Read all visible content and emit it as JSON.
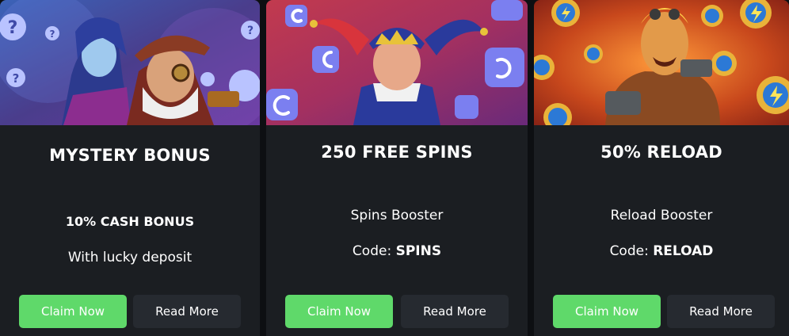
{
  "colors": {
    "accent_green": "#5fd96a",
    "card_bg": "#1b1e22",
    "button_dark": "#262a30"
  },
  "cards": [
    {
      "title": "MYSTERY BONUS",
      "line1": "10% CASH BONUS",
      "line2": "With lucky deposit",
      "claim_label": "Claim Now",
      "read_label": "Read More",
      "image_icons": [
        "question-mark-icon"
      ]
    },
    {
      "title": "250 FREE SPINS",
      "line1": "Spins Booster",
      "code_label": "Code:",
      "code_value": "SPINS",
      "claim_label": "Claim Now",
      "read_label": "Read More",
      "image_icons": [
        "spin-arrow-icon"
      ]
    },
    {
      "title": "50% RELOAD",
      "line1": "Reload Booster",
      "code_label": "Code:",
      "code_value": "RELOAD",
      "claim_label": "Claim Now",
      "read_label": "Read More",
      "image_icons": [
        "lightning-coin-icon"
      ]
    }
  ]
}
